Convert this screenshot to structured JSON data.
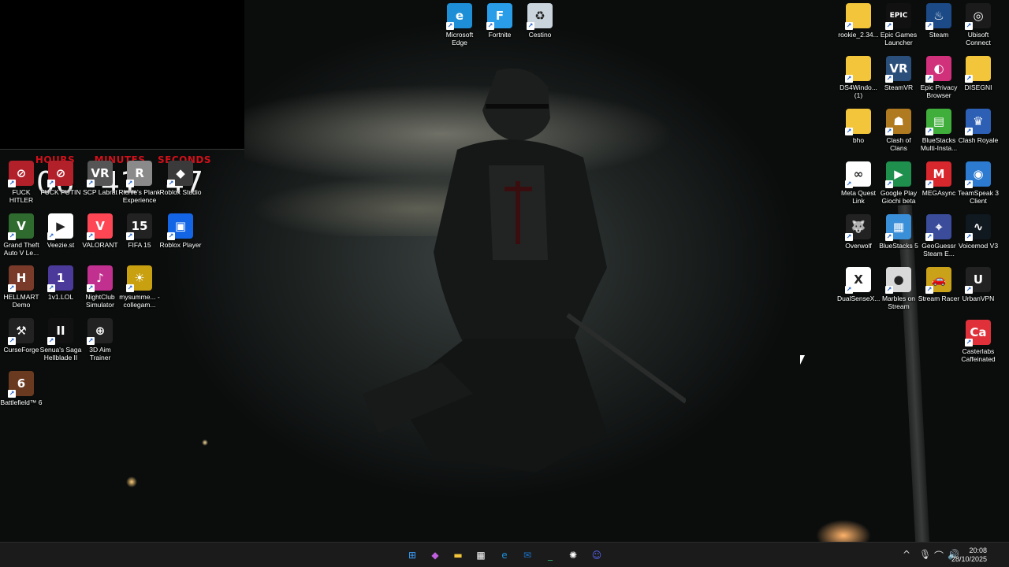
{
  "clock": {
    "hours_label": "HOURS",
    "minutes_label": "MINUTES",
    "seconds_label": "SECONDS",
    "hours": "06",
    "minutes": "41",
    "seconds": "47"
  },
  "desktop_icons_top": [
    {
      "label": "Microsoft Edge",
      "icon": "edge-icon",
      "glyph": "e",
      "color": "#1e8fd6"
    },
    {
      "label": "Fortnite",
      "icon": "fortnite-icon",
      "glyph": "F",
      "color": "#2a9de8"
    },
    {
      "label": "Cestino",
      "icon": "recycle-bin-icon",
      "glyph": "♻",
      "color": "#c9d4dd"
    }
  ],
  "desktop_icons_left": [
    {
      "label": "FUCK HITLER",
      "icon": "app-icon",
      "glyph": "⊘",
      "color": "#b2202a"
    },
    {
      "label": "FUCK PUTIN",
      "icon": "app-icon",
      "glyph": "⊘",
      "color": "#b2202a"
    },
    {
      "label": "SCP Labrat",
      "icon": "scp-labrat-icon",
      "glyph": "VR",
      "color": "#555"
    },
    {
      "label": "Richie's Plank Experience",
      "icon": "plank-icon",
      "glyph": "R",
      "color": "#8a8a8a"
    },
    {
      "label": "Roblox Studio",
      "icon": "roblox-studio-icon",
      "glyph": "◆",
      "color": "#3a3a3a"
    },
    {
      "label": "Grand Theft Auto V Le...",
      "icon": "gta-icon",
      "glyph": "V",
      "color": "#2f6b2f"
    },
    {
      "label": "Veezie.st",
      "icon": "veezie-icon",
      "glyph": "▶",
      "color": "#ffffff"
    },
    {
      "label": "VALORANT",
      "icon": "valorant-icon",
      "glyph": "V",
      "color": "#ff4655"
    },
    {
      "label": "FIFA 15",
      "icon": "fifa-icon",
      "glyph": "15",
      "color": "#222"
    },
    {
      "label": "Roblox Player",
      "icon": "roblox-player-icon",
      "glyph": "▣",
      "color": "#1465e6"
    },
    {
      "label": "HELLMART Demo",
      "icon": "hellmart-icon",
      "glyph": "H",
      "color": "#7a3a2a"
    },
    {
      "label": "1v1.LOL",
      "icon": "1v1lol-icon",
      "glyph": "1",
      "color": "#4b3a9a"
    },
    {
      "label": "NightClub Simulator",
      "icon": "nightclub-icon",
      "glyph": "♪",
      "color": "#c2308f"
    },
    {
      "label": "mysumme... - collegam...",
      "icon": "my-summer-car-icon",
      "glyph": "☀",
      "color": "#c8a010"
    },
    {
      "label": "CurseForge",
      "icon": "curseforge-icon",
      "glyph": "⚒",
      "color": "#222"
    },
    {
      "label": "Senua's Saga Hellblade II",
      "icon": "hellblade-icon",
      "glyph": "II",
      "color": "#111"
    },
    {
      "label": "3D Aim Trainer",
      "icon": "aim-trainer-icon",
      "glyph": "⊕",
      "color": "#222"
    },
    {
      "label": "Battlefield™ 6",
      "icon": "battlefield-icon",
      "glyph": "6",
      "color": "#6a3a20"
    }
  ],
  "desktop_icons_right": [
    {
      "label": "rookie_2.34...",
      "icon": "folder-icon",
      "glyph": "",
      "color": "#f3c53a"
    },
    {
      "label": "Epic Games Launcher",
      "icon": "epic-games-icon",
      "glyph": "EPIC",
      "color": "#111"
    },
    {
      "label": "Steam",
      "icon": "steam-icon",
      "glyph": "♨",
      "color": "#1b4a86"
    },
    {
      "label": "Ubisoft Connect",
      "icon": "ubisoft-icon",
      "glyph": "◎",
      "color": "#1b1b1b"
    },
    {
      "label": "DS4Windo... (1)",
      "icon": "folder-icon",
      "glyph": "",
      "color": "#f3c53a"
    },
    {
      "label": "SteamVR",
      "icon": "steamvr-icon",
      "glyph": "VR",
      "color": "#2a4f7a"
    },
    {
      "label": "Epic Privacy Browser",
      "icon": "epic-browser-icon",
      "glyph": "◐",
      "color": "#d1307a"
    },
    {
      "label": "DISEGNI",
      "icon": "folder-icon",
      "glyph": "",
      "color": "#f3c53a"
    },
    {
      "label": "bho",
      "icon": "folder-icon",
      "glyph": "",
      "color": "#f3c53a"
    },
    {
      "label": "Clash of Clans",
      "icon": "clash-of-clans-icon",
      "glyph": "☗",
      "color": "#b07a20"
    },
    {
      "label": "BlueStacks Multi-Insta...",
      "icon": "bluestacks-multi-icon",
      "glyph": "▤",
      "color": "#3fae3a"
    },
    {
      "label": "Clash Royale",
      "icon": "clash-royale-icon",
      "glyph": "♛",
      "color": "#2d5fb5"
    },
    {
      "label": "Meta Quest Link",
      "icon": "meta-quest-icon",
      "glyph": "∞",
      "color": "#ffffff"
    },
    {
      "label": "Google Play Giochi beta",
      "icon": "play-games-icon",
      "glyph": "▶",
      "color": "#1f8f4e"
    },
    {
      "label": "MEGAsync",
      "icon": "megasync-icon",
      "glyph": "M",
      "color": "#d9272e"
    },
    {
      "label": "TeamSpeak 3 Client",
      "icon": "teamspeak-icon",
      "glyph": "◉",
      "color": "#2c7bd0"
    },
    {
      "label": "Overwolf",
      "icon": "overwolf-icon",
      "glyph": "🐺",
      "color": "#222"
    },
    {
      "label": "BlueStacks 5",
      "icon": "bluestacks-icon",
      "glyph": "▦",
      "color": "#3a8fd9"
    },
    {
      "label": "GeoGuessr Steam E...",
      "icon": "geoguessr-icon",
      "glyph": "⌖",
      "color": "#3a4c9a"
    },
    {
      "label": "Voicemod V3",
      "icon": "voicemod-icon",
      "glyph": "∿",
      "color": "#101820"
    },
    {
      "label": "DualSenseX...",
      "icon": "dualsensex-icon",
      "glyph": "X",
      "color": "#ffffff"
    },
    {
      "label": "Marbles on Stream",
      "icon": "marbles-icon",
      "glyph": "●",
      "color": "#d9d9d9"
    },
    {
      "label": "Stream Racer",
      "icon": "stream-racer-icon",
      "glyph": "🚗",
      "color": "#c9a21a"
    },
    {
      "label": "UrbanVPN",
      "icon": "urbanvpn-icon",
      "glyph": "U",
      "color": "#222"
    },
    {
      "label": "Casterlabs Caffeinated",
      "icon": "casterlabs-icon",
      "glyph": "Ca",
      "color": "#e0313a"
    }
  ],
  "taskbar": {
    "apps": [
      {
        "name": "start-button",
        "glyph": "⊞",
        "color": "#3aa0ff"
      },
      {
        "name": "copilot-icon",
        "glyph": "◆",
        "color": "#c060e0"
      },
      {
        "name": "file-explorer-icon",
        "glyph": "▬",
        "color": "#f3c53a"
      },
      {
        "name": "microsoft-store-icon",
        "glyph": "▦",
        "color": "#ffffff"
      },
      {
        "name": "edge-taskbar-icon",
        "glyph": "e",
        "color": "#1e8fd6"
      },
      {
        "name": "outlook-icon",
        "glyph": "✉",
        "color": "#1a73c8"
      },
      {
        "name": "terminal-icon",
        "glyph": "_",
        "color": "#2aaa6a"
      },
      {
        "name": "chatgpt-icon",
        "glyph": "✺",
        "color": "#ffffff"
      },
      {
        "name": "discord-icon",
        "glyph": "☺",
        "color": "#5865f2"
      }
    ],
    "tray": {
      "chevron": "^",
      "mic": "🎙",
      "network": "⌒",
      "volume": "🔊"
    },
    "time": "20:08",
    "date": "28/10/2025"
  }
}
